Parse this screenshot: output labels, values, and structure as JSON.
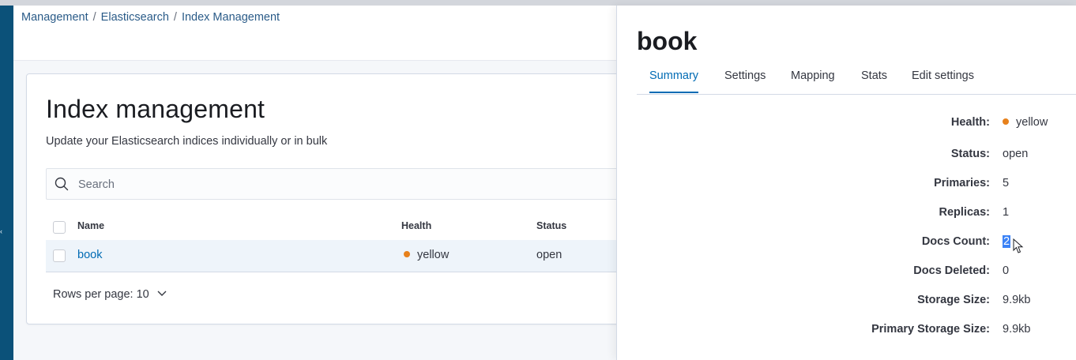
{
  "breadcrumb": {
    "items": [
      "Management",
      "Elasticsearch",
      "Index Management"
    ],
    "separator": "/"
  },
  "page": {
    "title": "Index management",
    "subtitle": "Update your Elasticsearch indices individually or in bulk"
  },
  "search": {
    "placeholder": "Search",
    "value": ""
  },
  "table": {
    "columns": [
      "Name",
      "Health",
      "Status"
    ],
    "rows": [
      {
        "name": "book",
        "health": "yellow",
        "status": "open"
      }
    ]
  },
  "pagination": {
    "rows_per_page_label": "Rows per page: 10"
  },
  "flyout": {
    "title": "book",
    "tabs": [
      "Summary",
      "Settings",
      "Mapping",
      "Stats",
      "Edit settings"
    ],
    "active_tab": "Summary",
    "summary": [
      {
        "label": "Health:",
        "value": "yellow"
      },
      {
        "label": "Status:",
        "value": "open"
      },
      {
        "label": "Primaries:",
        "value": "5"
      },
      {
        "label": "Replicas:",
        "value": "1"
      },
      {
        "label": "Docs Count:",
        "value": "2"
      },
      {
        "label": "Docs Deleted:",
        "value": "0"
      },
      {
        "label": "Storage Size:",
        "value": "9.9kb"
      },
      {
        "label": "Primary Storage Size:",
        "value": "9.9kb"
      }
    ]
  },
  "colors": {
    "link": "#006bb4",
    "health_yellow": "#e7811c",
    "side_nav": "#0b5179",
    "selection": "#3b82f6"
  },
  "icons": {
    "search": "search-icon",
    "chevron": "chevron-down-icon",
    "health": "status-dot-icon",
    "cursor": "mouse-cursor-icon"
  }
}
